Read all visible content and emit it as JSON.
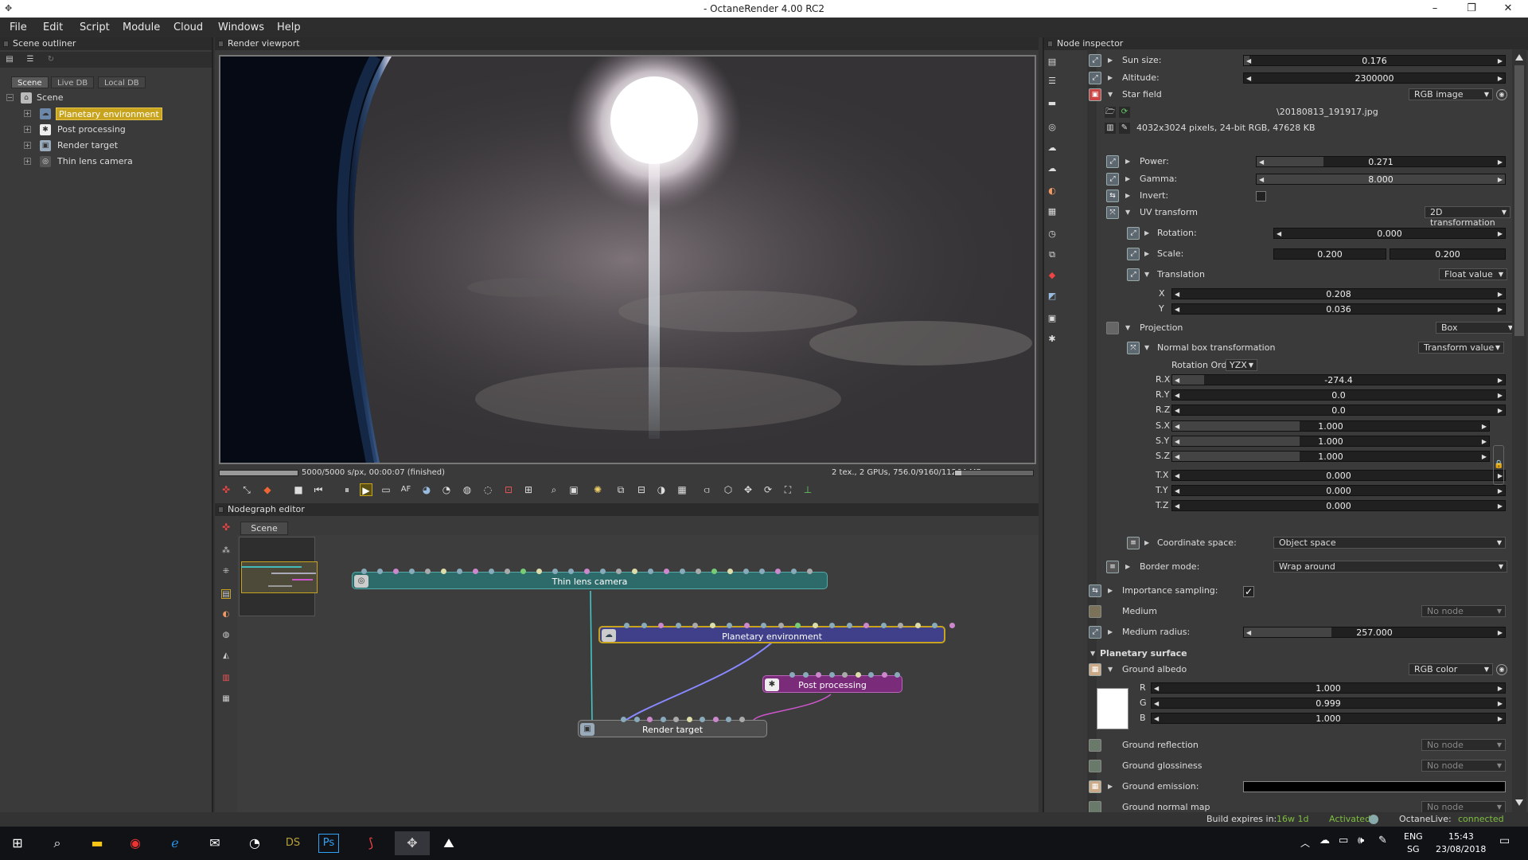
{
  "window": {
    "title": "- OctaneRender 4.00 RC2"
  },
  "menu": [
    "File",
    "Edit",
    "Script",
    "Module",
    "Cloud",
    "Windows",
    "Help"
  ],
  "outliner": {
    "title": "Scene outliner",
    "tabs": [
      "Scene",
      "Live DB",
      "Local DB"
    ],
    "root": "Scene",
    "items": [
      "Planetary environment",
      "Post processing",
      "Render target",
      "Thin lens camera"
    ]
  },
  "viewport": {
    "title": "Render viewport",
    "progress_text": "5000/5000 s/px, 00:00:07 (finished)",
    "progress": 1.0,
    "stats": "2 tex., 2 GPUs, 756.0/9160/11264 MB",
    "toolbar_text": "AF"
  },
  "nodegraph": {
    "title": "Nodegraph editor",
    "tab": "Scene",
    "nodes": [
      "Thin lens camera",
      "Planetary environment",
      "Post processing",
      "Render target"
    ]
  },
  "inspector": {
    "title": "Node inspector",
    "sun_size": {
      "label": "Sun size:",
      "value": "0.176",
      "fill": 0.02
    },
    "altitude": {
      "label": "Altitude:",
      "value": "2300000",
      "fill": 0.0
    },
    "star_field": {
      "label": "Star field",
      "type": "RGB image",
      "file": "\\20180813_191917.jpg",
      "info": "4032x3024 pixels, 24-bit RGB, 47628 KB"
    },
    "power": {
      "label": "Power:",
      "value": "0.271",
      "fill": 0.27
    },
    "gamma": {
      "label": "Gamma:",
      "value": "8.000",
      "fill": 1.0
    },
    "invert": {
      "label": "Invert:"
    },
    "uv_transform": {
      "label": "UV transform",
      "type": "2D transformation"
    },
    "rotation": {
      "label": "Rotation:",
      "value": "0.000"
    },
    "scale": {
      "label": "Scale:",
      "value1": "0.200",
      "value2": "0.200"
    },
    "translation": {
      "label": "Translation",
      "type": "Float value",
      "x_label": "X",
      "x": "0.208",
      "y_label": "Y",
      "y": "0.036"
    },
    "projection": {
      "label": "Projection",
      "type": "Box"
    },
    "normal_box": {
      "label": "Normal box transformation",
      "type": "Transform value",
      "rotation_order_label": "Rotation Order",
      "rotation_order": "YZX"
    },
    "box_values": [
      {
        "label": "R.X",
        "value": "-274.4"
      },
      {
        "label": "R.Y",
        "value": "0.0"
      },
      {
        "label": "R.Z",
        "value": "0.0"
      },
      {
        "label": "S.X",
        "value": "1.000"
      },
      {
        "label": "S.Y",
        "value": "1.000"
      },
      {
        "label": "S.Z",
        "value": "1.000"
      },
      {
        "label": "T.X",
        "value": "0.000"
      },
      {
        "label": "T.Y",
        "value": "0.000"
      },
      {
        "label": "T.Z",
        "value": "0.000"
      }
    ],
    "coord_space": {
      "label": "Coordinate space:",
      "value": "Object space"
    },
    "border_mode": {
      "label": "Border mode:",
      "value": "Wrap around"
    },
    "importance_sampling": {
      "label": "Importance sampling:",
      "checked": true
    },
    "medium": {
      "label": "Medium",
      "value": "No node"
    },
    "medium_radius": {
      "label": "Medium radius:",
      "value": "257.000"
    },
    "planetary_surface": {
      "label": "Planetary surface"
    },
    "ground_albedo": {
      "label": "Ground albedo",
      "type": "RGB color",
      "r_label": "R",
      "r": "1.000",
      "g_label": "G",
      "g": "0.999",
      "b_label": "B",
      "b": "1.000",
      "swatch": "#ffffff"
    },
    "ground_reflection": {
      "label": "Ground reflection",
      "value": "No node"
    },
    "ground_glossiness": {
      "label": "Ground glossiness",
      "value": "No node"
    },
    "ground_emission": {
      "label": "Ground emission:"
    },
    "ground_normal_map": {
      "label": "Ground normal map",
      "value": "No node"
    }
  },
  "status": {
    "build_label": "Build expires in:",
    "build_value": "16w 1d",
    "activated": "Activated",
    "live_label": "OctaneLive:",
    "live_value": "connected",
    "accent": "#7fbf3f"
  },
  "taskbar": {
    "lang1": "ENG",
    "lang2": "SG",
    "time": "15:43",
    "date": "23/08/2018",
    "ds_label": "DS",
    "ps_label": "Ps"
  },
  "colors": {
    "highlight": "#c8a41e",
    "camera_node": "#2d6a6a",
    "env_node": "#3f3f8a",
    "post_node": "#7a2b7a",
    "target_node": "#4d4d4d"
  }
}
